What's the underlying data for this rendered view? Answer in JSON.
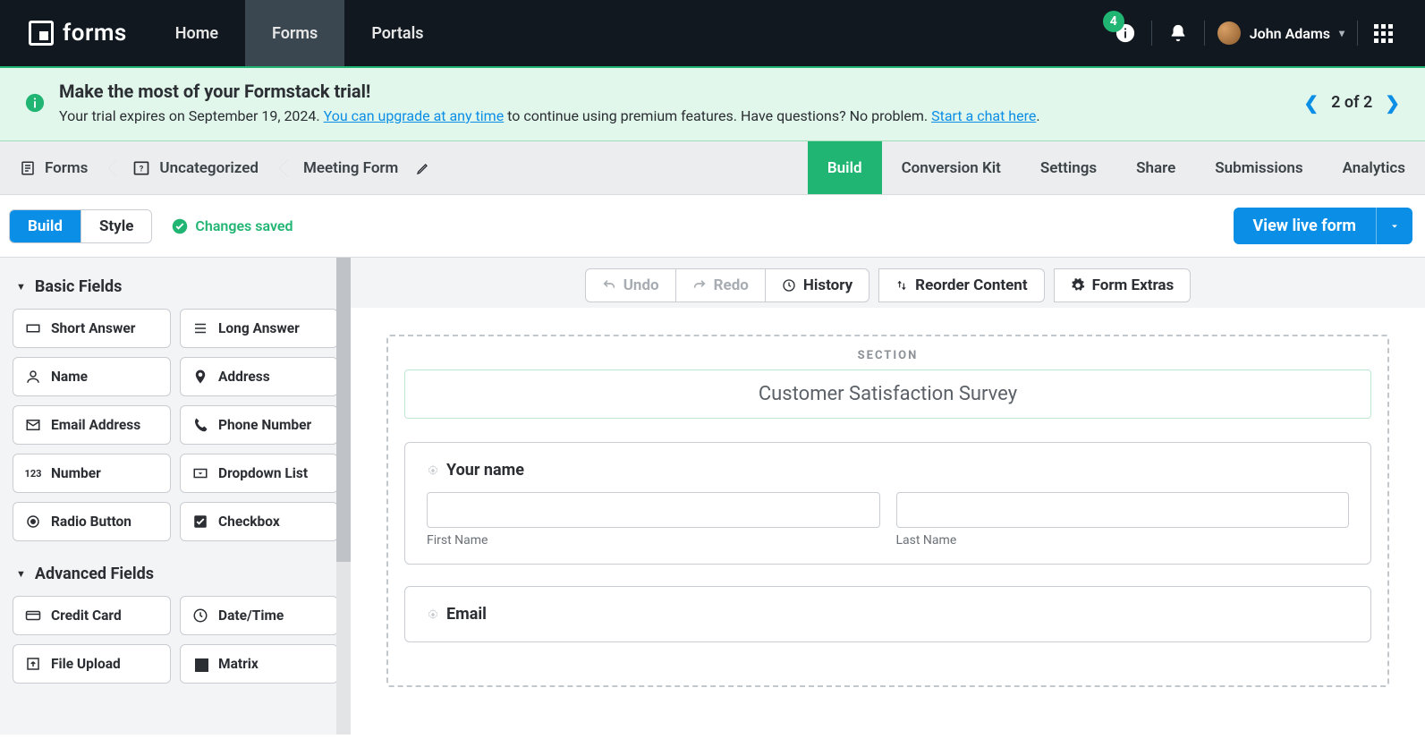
{
  "brand": "forms",
  "nav": {
    "home": "Home",
    "forms": "Forms",
    "portals": "Portals"
  },
  "notif_badge": "4",
  "user_name": "John Adams",
  "banner": {
    "title": "Make the most of your Formstack trial!",
    "sub_pre": "Your trial expires on September 19, 2024. ",
    "link1": "You can upgrade at any time",
    "sub_mid": " to continue using premium features. Have questions? No problem. ",
    "link2": "Start a chat here",
    "sub_post": ".",
    "pager": "2 of 2"
  },
  "crumbs": {
    "forms": "Forms",
    "cat": "Uncategorized",
    "name": "Meeting Form"
  },
  "subtabs": {
    "build": "Build",
    "conv": "Conversion Kit",
    "settings": "Settings",
    "share": "Share",
    "subs": "Submissions",
    "analytics": "Analytics"
  },
  "toolbar": {
    "build": "Build",
    "style": "Style",
    "saved": "Changes saved",
    "live": "View live form"
  },
  "canvas_tools": {
    "undo": "Undo",
    "redo": "Redo",
    "history": "History",
    "reorder": "Reorder Content",
    "extras": "Form Extras"
  },
  "sidebar": {
    "basic_h": "Basic Fields",
    "adv_h": "Advanced Fields",
    "basic": {
      "short": "Short Answer",
      "long": "Long Answer",
      "name": "Name",
      "address": "Address",
      "email": "Email Address",
      "phone": "Phone Number",
      "number": "Number",
      "dropdown": "Dropdown List",
      "radio": "Radio Button",
      "checkbox": "Checkbox"
    },
    "adv": {
      "credit": "Credit Card",
      "datetime": "Date/Time",
      "upload": "File Upload",
      "matrix": "Matrix"
    }
  },
  "form": {
    "section_label": "SECTION",
    "section_title": "Customer Satisfaction Survey",
    "name_label": "Your name",
    "first": "First Name",
    "last": "Last Name",
    "email_label": "Email"
  },
  "icon_text": {
    "num123": "123"
  }
}
